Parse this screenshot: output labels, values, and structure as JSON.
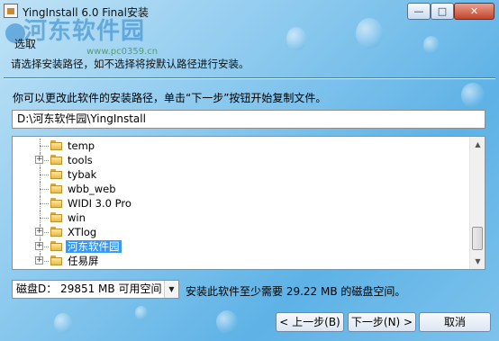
{
  "window": {
    "title": "YingInstall 6.0 Final安装",
    "controls": {
      "minimize": "—",
      "maximize": "□",
      "close": "✕"
    }
  },
  "watermark": {
    "text": "河东软件园",
    "url": "www.pc0359.cn"
  },
  "header": {
    "title": "选取",
    "subtitle": "请选择安装路径，如不选择将按默认路径进行安装。"
  },
  "instruction": "你可以更改此软件的安装路径，单击“下一步”按钮开始复制文件。",
  "path_input": {
    "value": "D:\\河东软件园\\YingInstall"
  },
  "folder_tree": {
    "items": [
      {
        "label": "temp",
        "expandable": false,
        "selected": false
      },
      {
        "label": "tools",
        "expandable": true,
        "selected": false
      },
      {
        "label": "tybak",
        "expandable": false,
        "selected": false
      },
      {
        "label": "wbb_web",
        "expandable": false,
        "selected": false
      },
      {
        "label": "WIDI 3.0 Pro",
        "expandable": false,
        "selected": false
      },
      {
        "label": "win",
        "expandable": false,
        "selected": false
      },
      {
        "label": "XTlog",
        "expandable": true,
        "selected": false
      },
      {
        "label": "河东软件园",
        "expandable": true,
        "selected": true
      },
      {
        "label": "任易屏",
        "expandable": true,
        "selected": false
      }
    ]
  },
  "drive_select": {
    "value": "磁盘D：  29851 MB 可用空间"
  },
  "space_note": "安装此软件至少需要 29.22 MB 的磁盘空间。",
  "buttons": {
    "back": "< 上一步(B)",
    "next": "下一步(N) >",
    "cancel": "取消"
  },
  "icons": {
    "app": "installer-icon",
    "folder": "folder-icon",
    "expander": "plus-box-icon",
    "dropdown": "chevron-down-icon"
  }
}
